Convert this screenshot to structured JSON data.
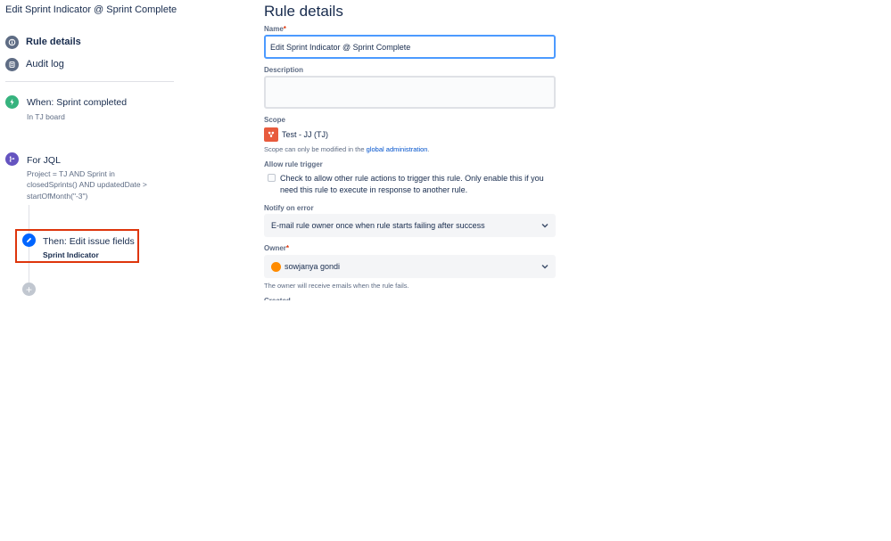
{
  "app": {
    "title": "Edit Sprint Indicator @ Sprint Complete"
  },
  "nav": {
    "rule_details": "Rule details",
    "audit_log": "Audit log"
  },
  "steps": {
    "trigger": {
      "title": "When: Sprint completed",
      "sub": "In TJ board",
      "icon": "lightning-icon",
      "color": "#36b37e"
    },
    "condition": {
      "title": "For JQL",
      "sub_lines": [
        "Project = TJ AND Sprint in",
        "closedSprints() AND updatedDate >",
        "startOfMonth(\"-3\")"
      ],
      "icon": "branch-icon",
      "color": "#6554c0"
    },
    "action": {
      "title": "Then: Edit issue fields",
      "sub": "Sprint Indicator",
      "icon": "pencil-icon",
      "color": "#0065ff",
      "highlight": "#de350b"
    },
    "add": {
      "icon": "plus-icon",
      "label": "+"
    }
  },
  "form": {
    "heading": "Rule details",
    "name": {
      "label": "Name",
      "required": "*",
      "value": "Edit Sprint Indicator @ Sprint Complete"
    },
    "description": {
      "label": "Description",
      "value": ""
    },
    "scope": {
      "label": "Scope",
      "project": "Test - JJ (TJ)",
      "note_prefix": "Scope can only be modified in the",
      "note_link": "global administration",
      "note_suffix": "."
    },
    "allow_trigger": {
      "label": "Allow rule trigger",
      "checked": false,
      "text": "Check to allow other rule actions to trigger this rule. Only enable this if you need this rule to execute in response to another rule."
    },
    "notify": {
      "label": "Notify on error",
      "value": "E-mail rule owner once when rule starts failing after success"
    },
    "owner": {
      "label": "Owner",
      "required": "*",
      "value": "sowjanya gondi",
      "note": "The owner will receive emails when the rule fails."
    },
    "created": {
      "label": "Created"
    }
  }
}
